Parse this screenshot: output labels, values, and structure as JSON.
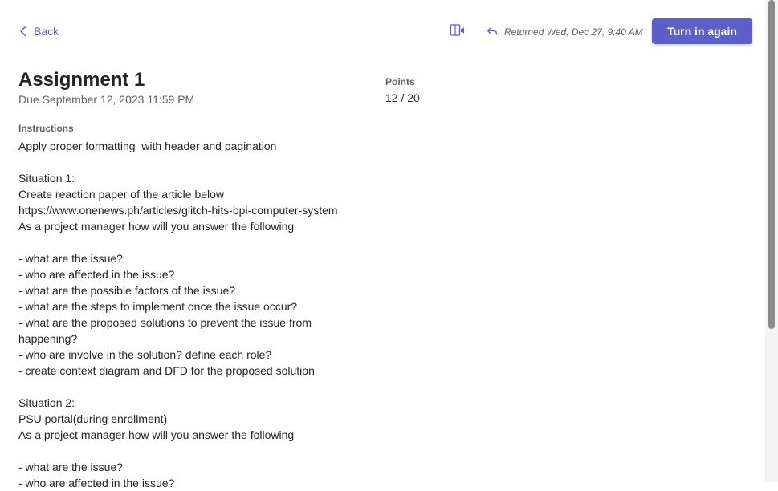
{
  "header": {
    "back_label": "Back",
    "returned_text": "Returned Wed, Dec 27, 9:40 AM",
    "turn_in_label": "Turn in again"
  },
  "assignment": {
    "title": "Assignment 1",
    "due": "Due September 12, 2023 11:59 PM",
    "points_label": "Points",
    "points_value": "12 / 20",
    "instructions_label": "Instructions",
    "instructions_lines": [
      "Apply proper formatting  with header and pagination",
      "",
      "Situation 1:",
      "Create reaction paper of the article below",
      "https://www.onenews.ph/articles/glitch-hits-bpi-computer-system",
      "As a project manager how will you answer the following",
      "",
      "- what are the issue?",
      "- who are affected in the issue?",
      "- what are the possible factors of the issue?",
      "- what are the steps to implement once the issue occur?",
      "- what are the proposed solutions to prevent the issue from",
      "happening?",
      "- who are involve in the solution? define each role?",
      "- create context diagram and DFD for the proposed solution",
      "",
      "Situation 2:",
      "PSU portal(during enrollment)",
      "As a project manager how will you answer the following",
      "",
      "- what are the issue?",
      "- who are affected in the issue?"
    ]
  },
  "colors": {
    "accent": "#5b5fc7",
    "text_primary": "#242424",
    "text_secondary": "#616161"
  },
  "icons": {
    "back": "chevron-left-icon",
    "reader": "immersive-reader-icon",
    "returned": "return-arrow-icon"
  }
}
